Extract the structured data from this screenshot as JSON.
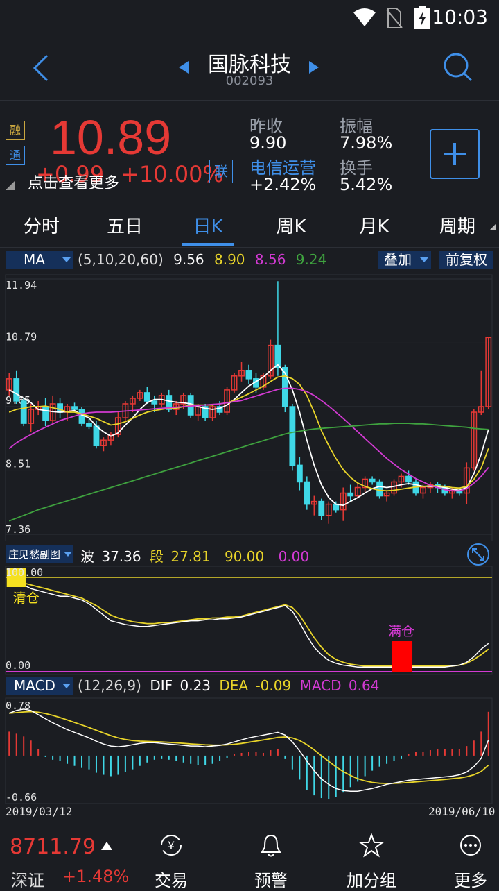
{
  "status": {
    "time": "10:03"
  },
  "header": {
    "title": "国脉科技",
    "code": "002093"
  },
  "quote": {
    "tags": [
      "融",
      "通"
    ],
    "price": "10.89",
    "change": "+0.99",
    "change_pct": "+10.00%",
    "link_label": "联",
    "hint": "点击查看更多",
    "prev_close_label": "昨收",
    "prev_close": "9.90",
    "amplitude_label": "振幅",
    "amplitude": "7.98%",
    "sector": "电信运营",
    "sector_change": "+2.42%",
    "turnover_label": "换手",
    "turnover": "5.42%"
  },
  "tabs": [
    {
      "label": "分时"
    },
    {
      "label": "五日"
    },
    {
      "label": "日K"
    },
    {
      "label": "周K"
    },
    {
      "label": "月K"
    },
    {
      "label": "周期"
    }
  ],
  "ma_bar": {
    "select": "MA",
    "params": "(5,10,20,60)",
    "v1": "9.56",
    "v2": "8.90",
    "v3": "8.56",
    "v4": "9.24",
    "overlay": "叠加",
    "adjust": "前复权",
    "colors": {
      "ma5": "#ffffff",
      "ma10": "#e8d42a",
      "ma20": "#d23ad2",
      "ma60": "#3fa33f"
    }
  },
  "ind1": {
    "select": "庄见愁副图",
    "wave_label": "波",
    "wave": "37.36",
    "seg_label": "段",
    "seg": "27.81",
    "v3": "90.00",
    "v4": "0.00",
    "top": "100.00",
    "bottom": "0.00",
    "clear_label": "清仓",
    "full_label": "满仓"
  },
  "macd": {
    "select": "MACD",
    "params": "(12,26,9)",
    "dif_label": "DIF",
    "dif": "0.23",
    "dea_label": "DEA",
    "dea": "-0.09",
    "macd_label": "MACD",
    "macd": "0.64",
    "top": "0.78",
    "bottom": "-0.66"
  },
  "dates": {
    "start": "2019/03/12",
    "end": "2019/06/10"
  },
  "bottom": {
    "index_value": "8711.79",
    "index_name": "深证",
    "index_change": "+1.48%",
    "items": [
      {
        "label": "交易",
        "icon": "yuan-exchange-icon"
      },
      {
        "label": "预警",
        "icon": "bell-icon"
      },
      {
        "label": "加分组",
        "icon": "star-icon"
      },
      {
        "label": "更多",
        "icon": "more-icon"
      }
    ]
  },
  "chart_data": {
    "type": "candlestick",
    "y_axis_labels": [
      "11.94",
      "10.79",
      "9.65",
      "8.51",
      "7.36"
    ],
    "ylim": [
      7.36,
      11.94
    ],
    "x_range": [
      "2019/03/12",
      "2019/06/10"
    ],
    "ohlc": [
      [
        9.95,
        10.25,
        9.85,
        10.15
      ],
      [
        10.15,
        10.3,
        9.7,
        9.75
      ],
      [
        9.75,
        9.8,
        9.3,
        9.35
      ],
      [
        9.35,
        9.7,
        9.2,
        9.6
      ],
      [
        9.6,
        9.75,
        9.5,
        9.65
      ],
      [
        9.65,
        9.8,
        9.3,
        9.4
      ],
      [
        9.4,
        9.85,
        9.35,
        9.7
      ],
      [
        9.7,
        9.8,
        9.45,
        9.55
      ],
      [
        9.55,
        9.7,
        9.4,
        9.65
      ],
      [
        9.65,
        9.72,
        9.55,
        9.6
      ],
      [
        9.6,
        9.65,
        9.3,
        9.35
      ],
      [
        9.35,
        9.45,
        9.25,
        9.3
      ],
      [
        9.3,
        9.4,
        8.9,
        8.95
      ],
      [
        8.95,
        9.1,
        8.85,
        9.05
      ],
      [
        9.05,
        9.2,
        8.95,
        9.15
      ],
      [
        9.15,
        9.55,
        9.1,
        9.45
      ],
      [
        9.45,
        9.75,
        9.4,
        9.7
      ],
      [
        9.7,
        9.85,
        9.55,
        9.8
      ],
      [
        9.8,
        9.95,
        9.75,
        9.9
      ],
      [
        9.9,
        10.0,
        9.7,
        9.75
      ],
      [
        9.75,
        9.85,
        9.55,
        9.7
      ],
      [
        9.7,
        9.9,
        9.65,
        9.85
      ],
      [
        9.85,
        9.95,
        9.55,
        9.6
      ],
      [
        9.6,
        9.75,
        9.5,
        9.7
      ],
      [
        9.7,
        9.9,
        9.6,
        9.85
      ],
      [
        9.85,
        9.9,
        9.45,
        9.5
      ],
      [
        9.5,
        9.7,
        9.4,
        9.65
      ],
      [
        9.65,
        9.7,
        9.4,
        9.45
      ],
      [
        9.45,
        9.7,
        9.4,
        9.65
      ],
      [
        9.65,
        9.75,
        9.5,
        9.55
      ],
      [
        9.55,
        10.0,
        9.5,
        9.95
      ],
      [
        9.95,
        10.25,
        9.9,
        10.2
      ],
      [
        10.2,
        10.45,
        10.1,
        10.3
      ],
      [
        10.3,
        10.4,
        10.05,
        10.15
      ],
      [
        10.15,
        10.25,
        9.9,
        10.0
      ],
      [
        10.0,
        10.25,
        9.95,
        10.2
      ],
      [
        10.2,
        10.85,
        10.15,
        10.75
      ],
      [
        10.75,
        11.9,
        10.2,
        10.35
      ],
      [
        10.35,
        10.4,
        9.55,
        9.65
      ],
      [
        9.65,
        9.7,
        8.5,
        8.6
      ],
      [
        8.6,
        8.75,
        8.15,
        8.3
      ],
      [
        8.3,
        8.4,
        7.8,
        7.9
      ],
      [
        7.9,
        8.05,
        7.7,
        7.95
      ],
      [
        7.95,
        8.0,
        7.62,
        7.7
      ],
      [
        7.7,
        7.95,
        7.55,
        7.9
      ],
      [
        7.9,
        7.95,
        7.75,
        7.8
      ],
      [
        7.8,
        8.2,
        7.6,
        8.1
      ],
      [
        8.1,
        8.25,
        7.95,
        8.05
      ],
      [
        8.05,
        8.3,
        8.0,
        8.2
      ],
      [
        8.2,
        8.4,
        8.1,
        8.35
      ],
      [
        8.35,
        8.4,
        8.25,
        8.3
      ],
      [
        8.3,
        8.35,
        8.0,
        8.05
      ],
      [
        8.05,
        8.15,
        7.95,
        8.1
      ],
      [
        8.1,
        8.35,
        8.05,
        8.3
      ],
      [
        8.3,
        8.45,
        8.2,
        8.4
      ],
      [
        8.4,
        8.5,
        8.25,
        8.3
      ],
      [
        8.3,
        8.35,
        8.05,
        8.1
      ],
      [
        8.1,
        8.25,
        8.0,
        8.2
      ],
      [
        8.2,
        8.3,
        8.1,
        8.25
      ],
      [
        8.25,
        8.3,
        8.1,
        8.2
      ],
      [
        8.2,
        8.25,
        8.05,
        8.1
      ],
      [
        8.1,
        8.2,
        8.0,
        8.15
      ],
      [
        8.15,
        8.2,
        8.05,
        8.1
      ],
      [
        8.1,
        8.65,
        7.9,
        8.55
      ],
      [
        8.55,
        9.6,
        8.5,
        9.55
      ],
      [
        9.55,
        10.3,
        9.5,
        9.65
      ],
      [
        9.65,
        10.89,
        9.6,
        10.89
      ]
    ],
    "series": [
      {
        "name": "MA5",
        "values": [
          9.95,
          9.88,
          9.8,
          9.72,
          9.6,
          9.58,
          9.56,
          9.55,
          9.56,
          9.58,
          9.5,
          9.45,
          9.3,
          9.2,
          9.12,
          9.18,
          9.32,
          9.45,
          9.6,
          9.72,
          9.78,
          9.78,
          9.75,
          9.73,
          9.72,
          9.7,
          9.65,
          9.62,
          9.6,
          9.62,
          9.68,
          9.78,
          9.9,
          10.02,
          10.1,
          10.18,
          10.3,
          10.4,
          10.25,
          9.95,
          9.55,
          9.05,
          8.6,
          8.25,
          8.02,
          7.9,
          7.88,
          7.95,
          8.02,
          8.1,
          8.18,
          8.22,
          8.2,
          8.22,
          8.25,
          8.27,
          8.25,
          8.22,
          8.22,
          8.22,
          8.2,
          8.17,
          8.15,
          8.2,
          8.45,
          8.8,
          9.24
        ]
      },
      {
        "name": "MA10",
        "values": [
          9.55,
          9.6,
          9.62,
          9.65,
          9.65,
          9.66,
          9.63,
          9.6,
          9.55,
          9.55,
          9.52,
          9.48,
          9.44,
          9.38,
          9.32,
          9.34,
          9.38,
          9.44,
          9.5,
          9.55,
          9.58,
          9.6,
          9.62,
          9.62,
          9.65,
          9.68,
          9.68,
          9.68,
          9.68,
          9.7,
          9.72,
          9.76,
          9.82,
          9.88,
          9.95,
          10.02,
          10.1,
          10.18,
          10.2,
          10.15,
          10.05,
          9.85,
          9.55,
          9.22,
          8.95,
          8.72,
          8.52,
          8.38,
          8.28,
          8.22,
          8.18,
          8.15,
          8.14,
          8.15,
          8.17,
          8.19,
          8.21,
          8.22,
          8.23,
          8.23,
          8.22,
          8.2,
          8.19,
          8.22,
          8.35,
          8.55,
          8.9
        ]
      },
      {
        "name": "MA20",
        "values": [
          8.9,
          9.0,
          9.08,
          9.15,
          9.22,
          9.28,
          9.34,
          9.4,
          9.44,
          9.48,
          9.52,
          9.54,
          9.55,
          9.55,
          9.55,
          9.56,
          9.57,
          9.58,
          9.59,
          9.6,
          9.61,
          9.62,
          9.63,
          9.64,
          9.65,
          9.66,
          9.67,
          9.68,
          9.69,
          9.7,
          9.72,
          9.74,
          9.76,
          9.8,
          9.84,
          9.88,
          9.92,
          9.96,
          9.98,
          9.98,
          9.96,
          9.92,
          9.85,
          9.76,
          9.66,
          9.55,
          9.44,
          9.32,
          9.2,
          9.08,
          8.96,
          8.84,
          8.72,
          8.62,
          8.52,
          8.44,
          8.36,
          8.3,
          8.24,
          8.2,
          8.16,
          8.14,
          8.14,
          8.18,
          8.28,
          8.4,
          8.56
        ]
      },
      {
        "name": "MA60",
        "values": [
          7.6,
          7.65,
          7.7,
          7.75,
          7.8,
          7.84,
          7.88,
          7.92,
          7.96,
          8.0,
          8.04,
          8.08,
          8.12,
          8.16,
          8.2,
          8.24,
          8.28,
          8.32,
          8.36,
          8.4,
          8.44,
          8.48,
          8.52,
          8.56,
          8.6,
          8.64,
          8.68,
          8.72,
          8.76,
          8.8,
          8.84,
          8.88,
          8.92,
          8.96,
          9.0,
          9.04,
          9.08,
          9.12,
          9.16,
          9.19,
          9.21,
          9.23,
          9.25,
          9.26,
          9.27,
          9.28,
          9.29,
          9.3,
          9.31,
          9.32,
          9.33,
          9.34,
          9.34,
          9.35,
          9.35,
          9.35,
          9.34,
          9.34,
          9.33,
          9.32,
          9.31,
          9.3,
          9.29,
          9.28,
          9.26,
          9.25,
          9.24
        ]
      }
    ],
    "indicator": {
      "ylim": [
        0,
        100
      ],
      "line1": [
        100,
        96,
        92,
        88,
        86,
        84,
        82,
        80,
        80,
        78,
        76,
        72,
        66,
        60,
        54,
        52,
        50,
        49,
        48,
        48,
        49,
        50,
        51,
        52,
        53,
        54,
        54,
        55,
        55,
        56,
        56,
        57,
        58,
        60,
        62,
        64,
        66,
        68,
        70,
        64,
        52,
        38,
        26,
        18,
        12,
        9,
        7,
        6,
        5,
        5,
        5,
        5,
        5,
        5,
        5,
        5,
        5,
        5,
        5,
        5,
        5,
        6,
        7,
        10,
        16,
        24,
        30
      ],
      "line2": [
        100,
        97,
        94,
        92,
        90,
        88,
        86,
        84,
        82,
        80,
        78,
        74,
        70,
        65,
        60,
        57,
        55,
        53,
        52,
        51,
        51,
        52,
        52,
        53,
        54,
        55,
        56,
        56,
        57,
        57,
        58,
        58,
        59,
        61,
        63,
        65,
        67,
        69,
        71,
        68,
        60,
        48,
        36,
        26,
        18,
        13,
        10,
        8,
        7,
        6,
        6,
        6,
        6,
        6,
        6,
        6,
        6,
        6,
        6,
        6,
        6,
        6,
        7,
        9,
        13,
        18,
        24
      ],
      "markers": [
        {
          "x": 1,
          "label": "清仓"
        },
        {
          "x": 54,
          "label": "满仓"
        }
      ]
    },
    "macd_data": {
      "ylim": [
        -0.66,
        0.78
      ],
      "hist": [
        0.35,
        0.32,
        0.28,
        0.22,
        0.1,
        -0.02,
        -0.06,
        -0.08,
        -0.12,
        -0.15,
        -0.18,
        -0.2,
        -0.25,
        -0.28,
        -0.3,
        -0.28,
        -0.24,
        -0.2,
        -0.15,
        -0.1,
        -0.06,
        -0.05,
        -0.06,
        -0.08,
        -0.1,
        -0.12,
        -0.14,
        -0.14,
        -0.12,
        -0.08,
        -0.04,
        0.02,
        0.04,
        0.06,
        0.05,
        0.04,
        0.08,
        0.1,
        -0.05,
        -0.2,
        -0.35,
        -0.5,
        -0.58,
        -0.62,
        -0.64,
        -0.6,
        -0.54,
        -0.46,
        -0.38,
        -0.3,
        -0.22,
        -0.16,
        -0.12,
        -0.08,
        -0.05,
        0.02,
        0.05,
        0.06,
        0.08,
        0.09,
        0.1,
        0.1,
        0.1,
        0.14,
        0.22,
        0.35,
        0.64
      ],
      "dif": [
        0.62,
        0.66,
        0.68,
        0.66,
        0.6,
        0.54,
        0.48,
        0.43,
        0.38,
        0.34,
        0.3,
        0.26,
        0.21,
        0.17,
        0.14,
        0.13,
        0.14,
        0.16,
        0.18,
        0.19,
        0.19,
        0.18,
        0.17,
        0.16,
        0.15,
        0.14,
        0.14,
        0.13,
        0.14,
        0.15,
        0.17,
        0.2,
        0.23,
        0.26,
        0.28,
        0.3,
        0.32,
        0.34,
        0.3,
        0.2,
        0.07,
        -0.08,
        -0.22,
        -0.34,
        -0.42,
        -0.48,
        -0.51,
        -0.52,
        -0.52,
        -0.5,
        -0.48,
        -0.45,
        -0.42,
        -0.4,
        -0.38,
        -0.36,
        -0.35,
        -0.34,
        -0.33,
        -0.32,
        -0.31,
        -0.3,
        -0.28,
        -0.24,
        -0.16,
        -0.04,
        0.23
      ]
    }
  }
}
